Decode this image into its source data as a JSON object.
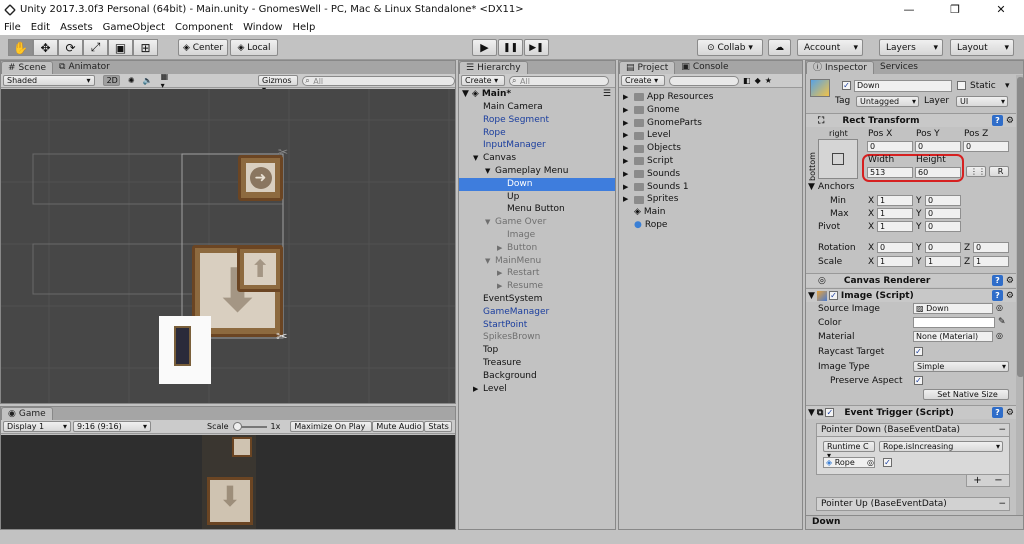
{
  "window": {
    "title": "Unity 2017.3.0f3 Personal (64bit) - Main.unity - GnomesWell - PC, Mac & Linux Standalone* <DX11>",
    "minimize": "—",
    "maximize": "❐",
    "close": "✕"
  },
  "menu": [
    "File",
    "Edit",
    "Assets",
    "GameObject",
    "Component",
    "Window",
    "Help"
  ],
  "toolbar": {
    "tools": [
      "✋",
      "✥",
      "⟳",
      "⤢",
      "▣",
      "⊞"
    ],
    "center_label": "Center",
    "local_label": "Local",
    "play": "▶",
    "pause": "❚❚",
    "step": "▶❚",
    "collab_label": "Collab ▾",
    "cloud": "☁",
    "account_label": "Account",
    "layers_label": "Layers",
    "layout_label": "Layout"
  },
  "scene": {
    "tab_scene": "Scene",
    "tab_animator": "Animator",
    "shading": "Shaded",
    "mode_2d": "2D",
    "gizmos": "Gizmos ▾",
    "search_placeholder": "All"
  },
  "game": {
    "tab": "Game",
    "display": "Display 1",
    "aspect": "9:16 (9:16)",
    "scale_label": "Scale",
    "scale_value": "1x",
    "maximize": "Maximize On Play",
    "mute": "Mute Audio",
    "stats": "Stats"
  },
  "hierarchy": {
    "tab": "Hierarchy",
    "create": "Create ▾",
    "search_placeholder": "All",
    "scene_name": "Main*",
    "items": [
      {
        "label": "Main Camera",
        "indent": 0,
        "style": "",
        "arrow": ""
      },
      {
        "label": "Rope Segment",
        "indent": 0,
        "style": "blue",
        "arrow": ""
      },
      {
        "label": "Rope",
        "indent": 0,
        "style": "blue",
        "arrow": ""
      },
      {
        "label": "InputManager",
        "indent": 0,
        "style": "blue",
        "arrow": ""
      },
      {
        "label": "Canvas",
        "indent": 0,
        "style": "",
        "arrow": "▼"
      },
      {
        "label": "Gameplay Menu",
        "indent": 1,
        "style": "",
        "arrow": "▼"
      },
      {
        "label": "Down",
        "indent": 2,
        "style": "sel",
        "arrow": ""
      },
      {
        "label": "Up",
        "indent": 2,
        "style": "",
        "arrow": ""
      },
      {
        "label": "Menu Button",
        "indent": 2,
        "style": "",
        "arrow": ""
      },
      {
        "label": "Game Over",
        "indent": 1,
        "style": "grey",
        "arrow": "▼"
      },
      {
        "label": "Image",
        "indent": 2,
        "style": "grey",
        "arrow": ""
      },
      {
        "label": "Button",
        "indent": 2,
        "style": "grey",
        "arrow": "▶"
      },
      {
        "label": "MainMenu",
        "indent": 1,
        "style": "grey",
        "arrow": "▼"
      },
      {
        "label": "Restart",
        "indent": 2,
        "style": "grey",
        "arrow": "▶"
      },
      {
        "label": "Resume",
        "indent": 2,
        "style": "grey",
        "arrow": "▶"
      },
      {
        "label": "EventSystem",
        "indent": 0,
        "style": "",
        "arrow": ""
      },
      {
        "label": "GameManager",
        "indent": 0,
        "style": "blue",
        "arrow": ""
      },
      {
        "label": "StartPoint",
        "indent": 0,
        "style": "blue",
        "arrow": ""
      },
      {
        "label": "SpikesBrown",
        "indent": 0,
        "style": "grey",
        "arrow": ""
      },
      {
        "label": "Top",
        "indent": 0,
        "style": "",
        "arrow": ""
      },
      {
        "label": "Treasure",
        "indent": 0,
        "style": "",
        "arrow": ""
      },
      {
        "label": "Background",
        "indent": 0,
        "style": "",
        "arrow": ""
      },
      {
        "label": "Level",
        "indent": 0,
        "style": "",
        "arrow": "▶"
      }
    ]
  },
  "project": {
    "tab_project": "Project",
    "tab_console": "Console",
    "create": "Create ▾",
    "items": [
      {
        "label": "App Resources",
        "icon": "folder"
      },
      {
        "label": "Gnome",
        "icon": "folder"
      },
      {
        "label": "GnomeParts",
        "icon": "folder"
      },
      {
        "label": "Level",
        "icon": "folder"
      },
      {
        "label": "Objects",
        "icon": "folder"
      },
      {
        "label": "Script",
        "icon": "folder"
      },
      {
        "label": "Sounds",
        "icon": "folder"
      },
      {
        "label": "Sounds 1",
        "icon": "folder"
      },
      {
        "label": "Sprites",
        "icon": "folder"
      },
      {
        "label": "Main",
        "icon": "unity"
      },
      {
        "label": "Rope",
        "icon": "prefab"
      }
    ]
  },
  "inspector": {
    "tab_inspector": "Inspector",
    "tab_services": "Services",
    "object_name": "Down",
    "static_label": "Static",
    "tag_label": "Tag",
    "tag_value": "Untagged",
    "layer_label": "Layer",
    "layer_value": "UI",
    "rect": {
      "title": "Rect Transform",
      "anchor_top": "right",
      "anchor_side": "bottom",
      "posx_label": "Pos X",
      "posy_label": "Pos Y",
      "posz_label": "Pos Z",
      "posx": "0",
      "posy": "0",
      "posz": "0",
      "width_label": "Width",
      "height_label": "Height",
      "width": "513",
      "height": "60",
      "r_btn": "R",
      "anchors_label": "Anchors",
      "min_label": "Min",
      "max_label": "Max",
      "pivot_label": "Pivot",
      "min_x": "1",
      "min_y": "0",
      "max_x": "1",
      "max_y": "0",
      "pivot_x": "1",
      "pivot_y": "0",
      "rotation_label": "Rotation",
      "rot_x": "0",
      "rot_y": "0",
      "rot_z": "0",
      "scale_label": "Scale",
      "scale_x": "1",
      "scale_y": "1",
      "scale_z": "1"
    },
    "canvas_renderer": "Canvas Renderer",
    "image": {
      "title": "Image (Script)",
      "source_label": "Source Image",
      "source_value": "Down",
      "color_label": "Color",
      "material_label": "Material",
      "material_value": "None (Material)",
      "raycast_label": "Raycast Target",
      "type_label": "Image Type",
      "type_value": "Simple",
      "preserve_label": "Preserve Aspect",
      "native_btn": "Set Native Size"
    },
    "event_trigger": {
      "title": "Event Trigger (Script)",
      "pointer_down": "Pointer Down (BaseEventData)",
      "runtime": "Runtime C ▾",
      "method": "Rope.isIncreasing",
      "target": "Rope",
      "plus": "+",
      "minus": "−",
      "pointer_up": "Pointer Up (BaseEventData)"
    },
    "footer_label": "Down"
  },
  "colors": {
    "highlight": "#d62020",
    "selection": "#3e7ddd",
    "scene_bg": "#474747"
  }
}
